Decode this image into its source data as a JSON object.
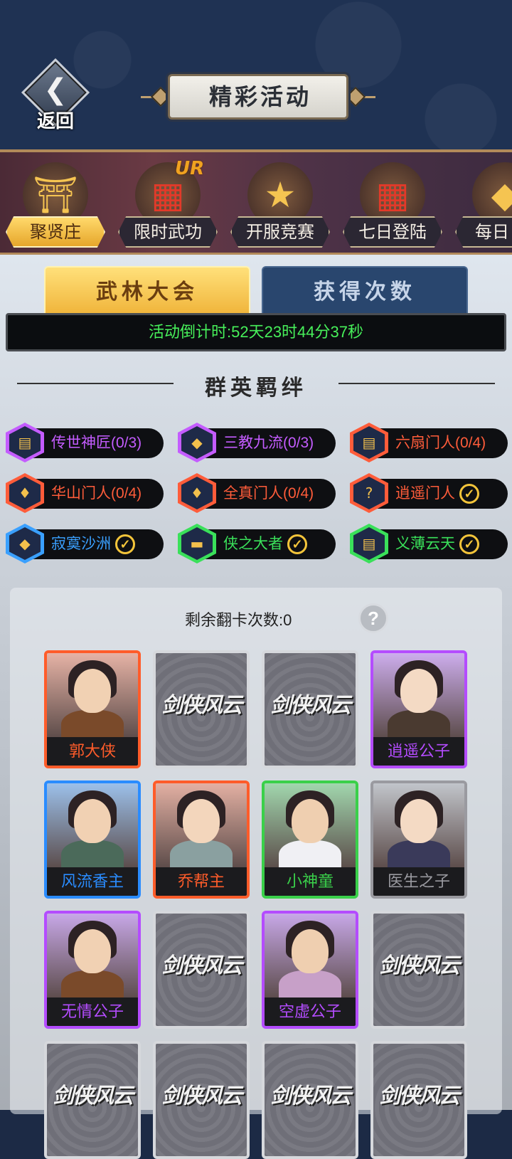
{
  "header": {
    "back_label": "返回",
    "title": "精彩活动"
  },
  "categories": [
    {
      "label": "聚贤庄",
      "icon": "pavilion-icon",
      "active": true
    },
    {
      "label": "限时武功",
      "icon": "scroll-book-icon",
      "badge": "UR"
    },
    {
      "label": "开服竞赛",
      "icon": "trophy-icon"
    },
    {
      "label": "七日登陆",
      "icon": "gift-book-icon"
    },
    {
      "label": "每日",
      "icon": "gold-chest-icon"
    }
  ],
  "tabs": [
    {
      "label": "武林大会",
      "active": true
    },
    {
      "label": "获得次数",
      "active": false
    }
  ],
  "countdown": "活动倒计时:52天23时44分37秒",
  "section_title": "群英羁绊",
  "bonds": [
    {
      "name": "传世神匠",
      "progress": "(0/3)",
      "color": "#c45cff",
      "icon": "book-icon",
      "done": false
    },
    {
      "name": "三教九流",
      "progress": "(0/3)",
      "color": "#c45cff",
      "icon": "crystal-icon",
      "done": false
    },
    {
      "name": "六扇门人",
      "progress": "(0/4)",
      "color": "#ff5c3a",
      "icon": "book-icon",
      "done": false
    },
    {
      "name": "华山门人",
      "progress": "(0/4)",
      "color": "#ff5c3a",
      "icon": "flame-crystal-icon",
      "done": false
    },
    {
      "name": "全真门人",
      "progress": "(0/4)",
      "color": "#ff5c3a",
      "icon": "flame-crystal-icon",
      "done": false
    },
    {
      "name": "逍遥门人",
      "progress": "",
      "color": "#ff5c3a",
      "icon": "mystery-book-icon",
      "done": true
    },
    {
      "name": "寂寞沙洲",
      "progress": "",
      "color": "#3aa0ff",
      "icon": "crystal-icon",
      "done": true
    },
    {
      "name": "侠之大者",
      "progress": "",
      "color": "#3ae05a",
      "icon": "gold-ingot-icon",
      "done": true
    },
    {
      "name": "义薄云天",
      "progress": "",
      "color": "#3ae05a",
      "icon": "book-icon",
      "done": true
    }
  ],
  "flip_count": "剩余翻卡次数:0",
  "help_label": "?",
  "card_back_logo": "剑侠风云",
  "cards": [
    {
      "name": "郭大侠",
      "revealed": true,
      "color": "#ff5c2a"
    },
    {
      "name": "",
      "revealed": false
    },
    {
      "name": "",
      "revealed": false
    },
    {
      "name": "逍遥公子",
      "revealed": true,
      "color": "#b44cff"
    },
    {
      "name": "风流香主",
      "revealed": true,
      "color": "#2a8cff"
    },
    {
      "name": "乔帮主",
      "revealed": true,
      "color": "#ff5c2a"
    },
    {
      "name": "小神童",
      "revealed": true,
      "color": "#3ad04a"
    },
    {
      "name": "医生之子",
      "revealed": true,
      "color": "#9a9aa0"
    },
    {
      "name": "无情公子",
      "revealed": true,
      "color": "#b44cff"
    },
    {
      "name": "",
      "revealed": false
    },
    {
      "name": "空虚公子",
      "revealed": true,
      "color": "#b44cff"
    },
    {
      "name": "",
      "revealed": false
    },
    {
      "name": "",
      "revealed": false
    },
    {
      "name": "",
      "revealed": false
    },
    {
      "name": "",
      "revealed": false
    },
    {
      "name": "",
      "revealed": false
    }
  ]
}
